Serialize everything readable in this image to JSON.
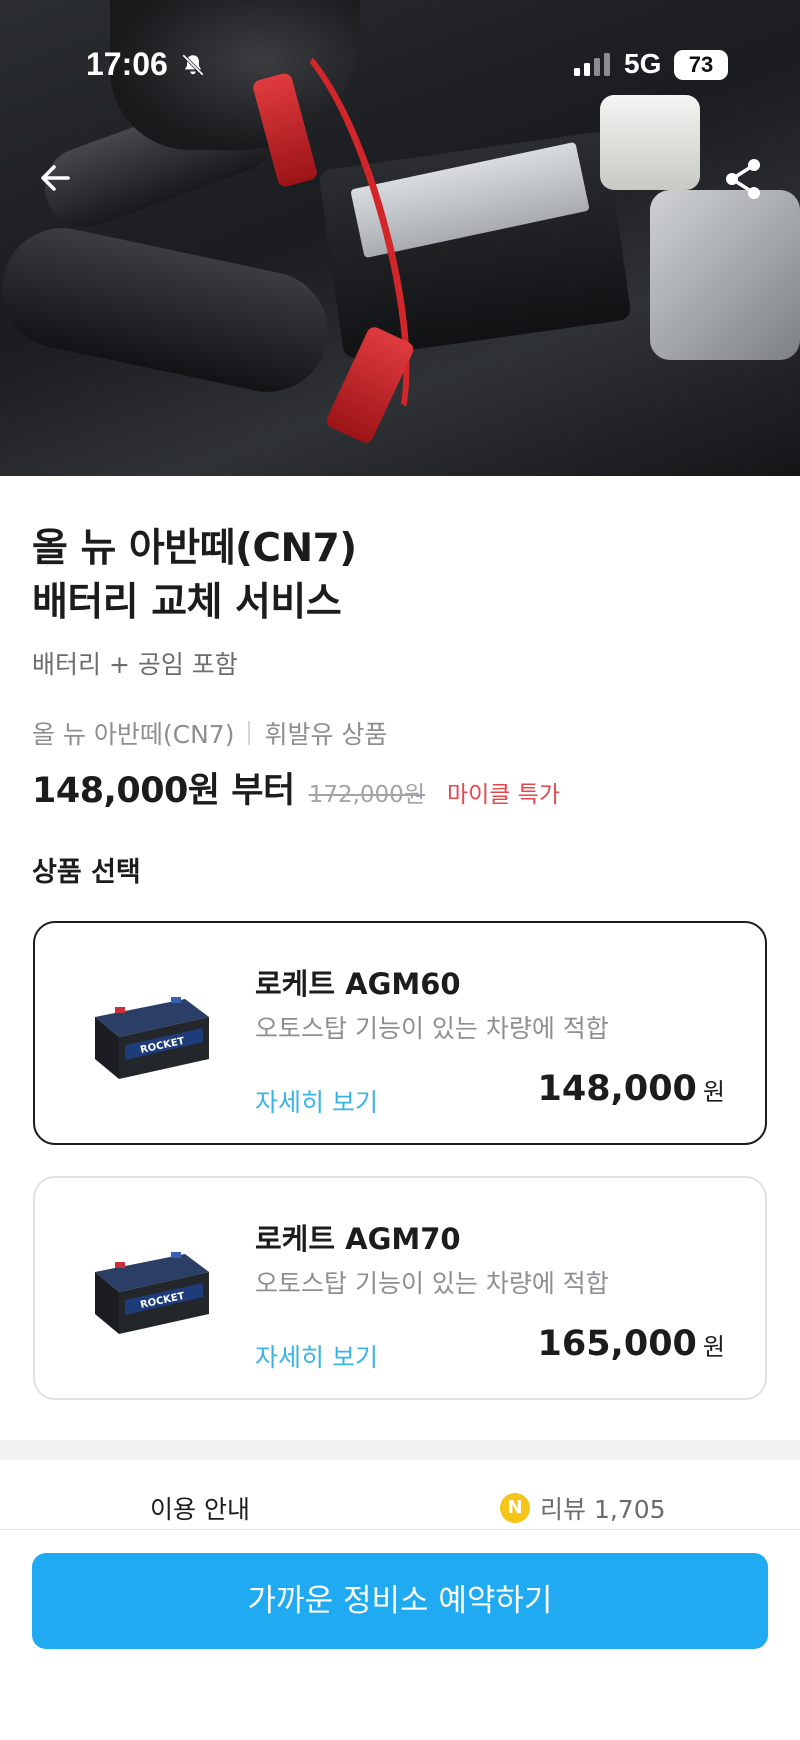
{
  "status_bar": {
    "time": "17:06",
    "network": "5G",
    "battery": "73"
  },
  "hero": {
    "image": "car-engine-battery-jumper-cables-photo"
  },
  "product": {
    "title_line1": "올 뉴 아반떼(CN7)",
    "title_line2": "배터리 교체 서비스",
    "subtitle": "배터리 + 공임 포함",
    "vehicle": "올 뉴 아반떼(CN7)",
    "fuel_type": "휘발유  상품",
    "price_from": "148,000원 부터",
    "original_price": "172,000원",
    "special_label": "마이클 특가"
  },
  "selection": {
    "label": "상품 선택",
    "options": [
      {
        "name": "로케트 AGM60",
        "desc": "오토스탑 기능이 있는 차량에 적합",
        "detail": "자세히 보기",
        "price": "148,000",
        "unit": "원",
        "selected": true
      },
      {
        "name": "로케트 AGM70",
        "desc": "오토스탑 기능이 있는 차량에 적합",
        "detail": "자세히 보기",
        "price": "165,000",
        "unit": "원",
        "selected": false
      }
    ]
  },
  "tabs": {
    "info": "이용 안내",
    "review_badge": "N",
    "review": "리뷰 1,705"
  },
  "cta": {
    "label": "가까운 정비소 예약하기"
  },
  "colors": {
    "accent": "#1faaf2",
    "link": "#3ab4e6",
    "special": "#e5484d"
  }
}
